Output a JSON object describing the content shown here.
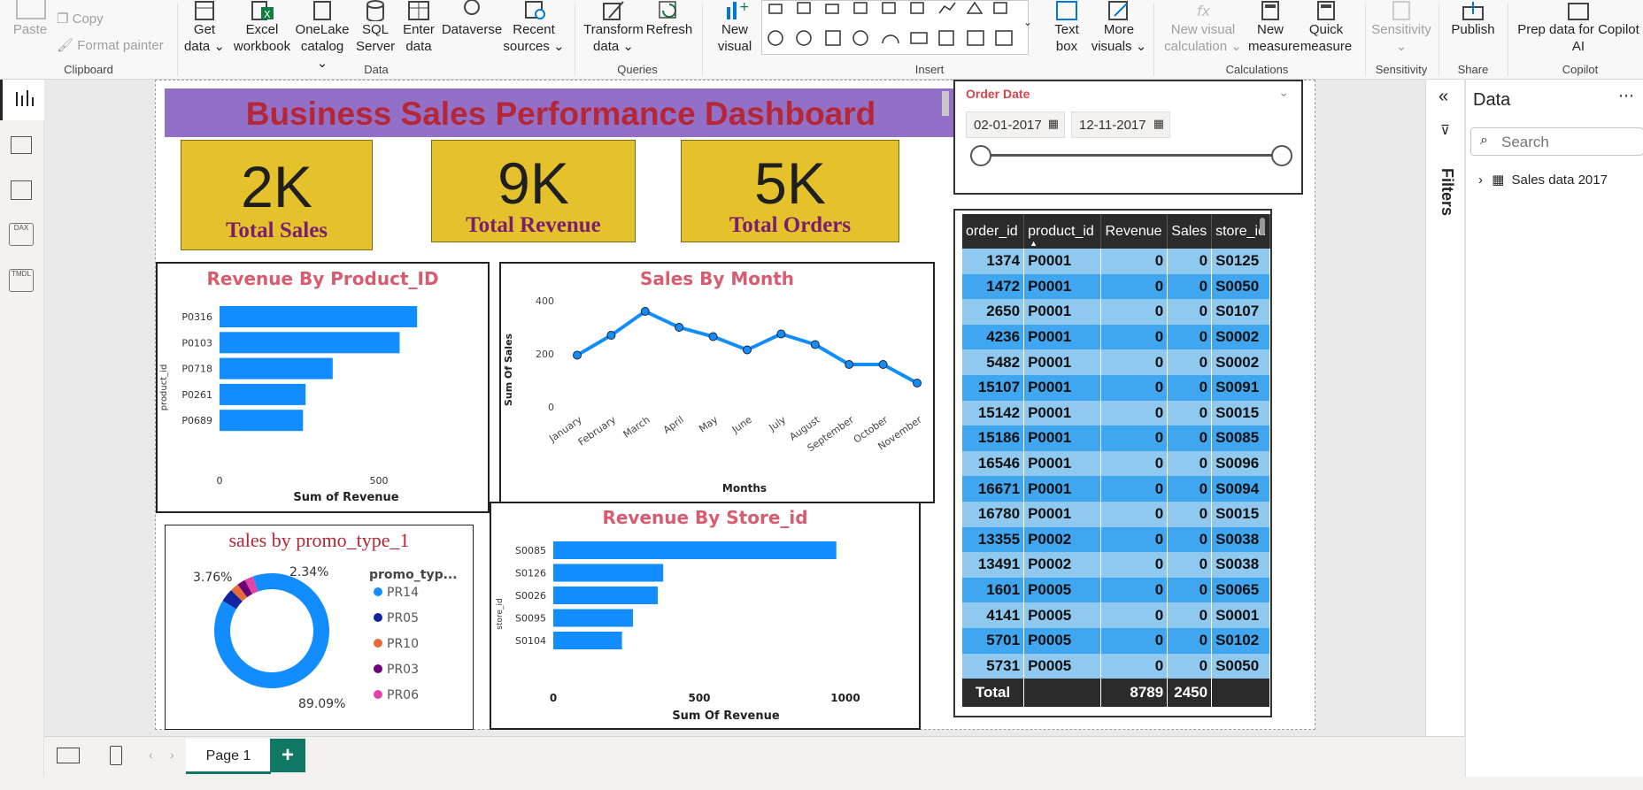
{
  "ribbon": {
    "clipboard": {
      "paste": "Paste",
      "copy": "Copy",
      "format_painter": "Format painter",
      "group": "Clipboard"
    },
    "data": {
      "get_data": "Get",
      "get_data2": "data",
      "excel": "Excel",
      "excel2": "workbook",
      "onelake": "OneLake",
      "onelake2": "catalog",
      "sql": "SQL",
      "sql2": "Server",
      "enter": "Enter",
      "enter2": "data",
      "dataverse": "Dataverse",
      "recent": "Recent",
      "recent2": "sources",
      "group": "Data"
    },
    "queries": {
      "transform": "Transform",
      "transform2": "data",
      "refresh": "Refresh",
      "group": "Queries"
    },
    "insert": {
      "new_visual": "New",
      "new_visual2": "visual",
      "text_box": "Text",
      "text_box2": "box",
      "more_visuals": "More",
      "more_visuals2": "visuals",
      "group": "Insert"
    },
    "calculations": {
      "new_visual_calc": "New visual",
      "new_visual_calc2": "calculation",
      "new_measure": "New",
      "new_measure2": "measure",
      "quick_measure": "Quick",
      "quick_measure2": "measure",
      "group": "Calculations"
    },
    "sensitivity": {
      "label": "Sensitivity",
      "group": "Sensitivity"
    },
    "share": {
      "publish": "Publish",
      "group": "Share"
    },
    "copilot": {
      "prep": "Prep data for Copilot",
      "prep2": "AI",
      "group": "Copilot"
    }
  },
  "report": {
    "title": "Business Sales Performance Dashboard",
    "cards": [
      {
        "value": "2K",
        "label": "Total Sales"
      },
      {
        "value": "9K",
        "label": "Total Revenue"
      },
      {
        "value": "5K",
        "label": "Total Orders"
      }
    ],
    "slicer": {
      "title": "Order Date",
      "start": "02-01-2017",
      "end": "12-11-2017"
    },
    "revenue_by_product": {
      "title": "Revenue By Product_ID",
      "ylabel": "product_id",
      "xlabel": "Sum of Revenue",
      "ticks": [
        "0",
        "500"
      ]
    },
    "sales_by_month": {
      "title": "Sales By Month",
      "ylabel": "Sum Of Sales",
      "xlabel": "Months",
      "yticks": [
        "400",
        "200",
        "0"
      ]
    },
    "promo": {
      "title": "sales by promo_type_1",
      "legend_title": "promo_typ...",
      "labels": [
        "3.76%",
        "2.34%",
        "89.09%"
      ]
    },
    "revenue_by_store": {
      "title": "Revenue By Store_id",
      "ylabel": "store_id",
      "xlabel": "Sum Of Revenue",
      "ticks": [
        "0",
        "500",
        "1000"
      ]
    },
    "table": {
      "headers": [
        "order_id",
        "product_id",
        "Revenue",
        "Sales",
        "store_id"
      ],
      "rows": [
        [
          "1374",
          "P0001",
          "0",
          "0",
          "S0125"
        ],
        [
          "1472",
          "P0001",
          "0",
          "0",
          "S0050"
        ],
        [
          "2650",
          "P0001",
          "0",
          "0",
          "S0107"
        ],
        [
          "4236",
          "P0001",
          "0",
          "0",
          "S0002"
        ],
        [
          "5482",
          "P0001",
          "0",
          "0",
          "S0002"
        ],
        [
          "15107",
          "P0001",
          "0",
          "0",
          "S0091"
        ],
        [
          "15142",
          "P0001",
          "0",
          "0",
          "S0015"
        ],
        [
          "15186",
          "P0001",
          "0",
          "0",
          "S0085"
        ],
        [
          "16546",
          "P0001",
          "0",
          "0",
          "S0096"
        ],
        [
          "16671",
          "P0001",
          "0",
          "0",
          "S0094"
        ],
        [
          "16780",
          "P0001",
          "0",
          "0",
          "S0015"
        ],
        [
          "13355",
          "P0002",
          "0",
          "0",
          "S0038"
        ],
        [
          "13491",
          "P0002",
          "0",
          "0",
          "S0038"
        ],
        [
          "1601",
          "P0005",
          "0",
          "0",
          "S0065"
        ],
        [
          "4141",
          "P0005",
          "0",
          "0",
          "S0001"
        ],
        [
          "5701",
          "P0005",
          "0",
          "0",
          "S0102"
        ],
        [
          "5731",
          "P0005",
          "0",
          "0",
          "S0050"
        ]
      ],
      "total_label": "Total",
      "total_revenue": "8789",
      "total_sales": "2450"
    }
  },
  "panes": {
    "filters": "Filters",
    "data_title": "Data",
    "search_placeholder": "Search",
    "table_name": "Sales data 2017"
  },
  "bottom": {
    "page_tab": "Page 1",
    "add": "+"
  },
  "chart_data": [
    {
      "type": "bar",
      "title": "Revenue By Product_ID",
      "xlabel": "Sum of Revenue",
      "ylabel": "product_id",
      "categories": [
        "P0316",
        "P0103",
        "P0718",
        "P0261",
        "P0689"
      ],
      "values": [
        620,
        565,
        355,
        270,
        262
      ],
      "xlim": [
        0,
        700
      ]
    },
    {
      "type": "line",
      "title": "Sales By Month",
      "xlabel": "Months",
      "ylabel": "Sum Of Sales",
      "x": [
        "January",
        "February",
        "March",
        "April",
        "May",
        "June",
        "July",
        "August",
        "September",
        "October",
        "November"
      ],
      "values": [
        195,
        270,
        360,
        300,
        265,
        215,
        275,
        235,
        160,
        160,
        90
      ],
      "ylim": [
        0,
        400
      ],
      "color": "#118dff"
    },
    {
      "type": "pie",
      "title": "sales by promo_type_1",
      "categories": [
        "PR14",
        "PR05",
        "PR10",
        "PR03",
        "PR06"
      ],
      "values": [
        89.09,
        3.76,
        2.4,
        2.34,
        2.41
      ],
      "colors": [
        "#118dff",
        "#12239e",
        "#e66c37",
        "#6b007b",
        "#e044a7"
      ]
    },
    {
      "type": "bar",
      "title": "Revenue By Store_id",
      "xlabel": "Sum Of Revenue",
      "ylabel": "store_id",
      "categories": [
        "S0085",
        "S0126",
        "S0026",
        "S0095",
        "S0104"
      ],
      "values": [
        1030,
        400,
        380,
        290,
        250
      ],
      "xlim": [
        0,
        1150
      ]
    }
  ]
}
